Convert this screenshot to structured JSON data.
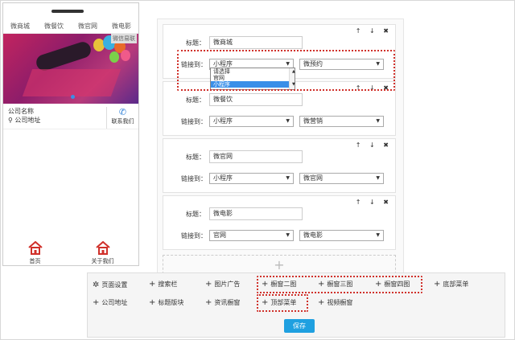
{
  "phone": {
    "nav": [
      "微商城",
      "微餐饮",
      "微官网",
      "微电影"
    ],
    "banner_stamp": "微信易联",
    "company_name": "公司名称",
    "company_address": "公司地址",
    "contact_label": "联系我们",
    "footer": [
      "首页",
      "关于我们"
    ]
  },
  "cards": [
    {
      "title_label": "标题：",
      "title_value": "微商城",
      "link_label": "链接到：",
      "select1": "小程序",
      "select2": "微预约"
    },
    {
      "title_label": "标题：",
      "title_value": "微餐饮",
      "link_label": "链接到：",
      "select1": "小程序",
      "select2": "微营销"
    },
    {
      "title_label": "标题：",
      "title_value": "微官网",
      "link_label": "链接到：",
      "select1": "小程序",
      "select2": "微官网"
    },
    {
      "title_label": "标题：",
      "title_value": "微电影",
      "link_label": "链接到：",
      "select1": "官网",
      "select2": "微电影"
    }
  ],
  "dropdown_options": [
    "请选择",
    "官网",
    "小程序"
  ],
  "dropdown_selected": "小程序",
  "card_controls": "↑ ↓ ✖",
  "add_symbol": "+",
  "toolbar": {
    "row1": [
      "页面设置",
      "搜索栏",
      "图片广告",
      "橱窗二图",
      "橱窗三图",
      "橱窗四图",
      "底部菜单"
    ],
    "row2": [
      "公司地址",
      "标题版块",
      "资讯橱窗",
      "顶部菜单",
      "视频橱窗"
    ],
    "save_label": "保存"
  },
  "colors": {
    "accent": "#1fa0e0",
    "highlight_border": "#d0302a",
    "selected_option": "#3a8fe8"
  }
}
